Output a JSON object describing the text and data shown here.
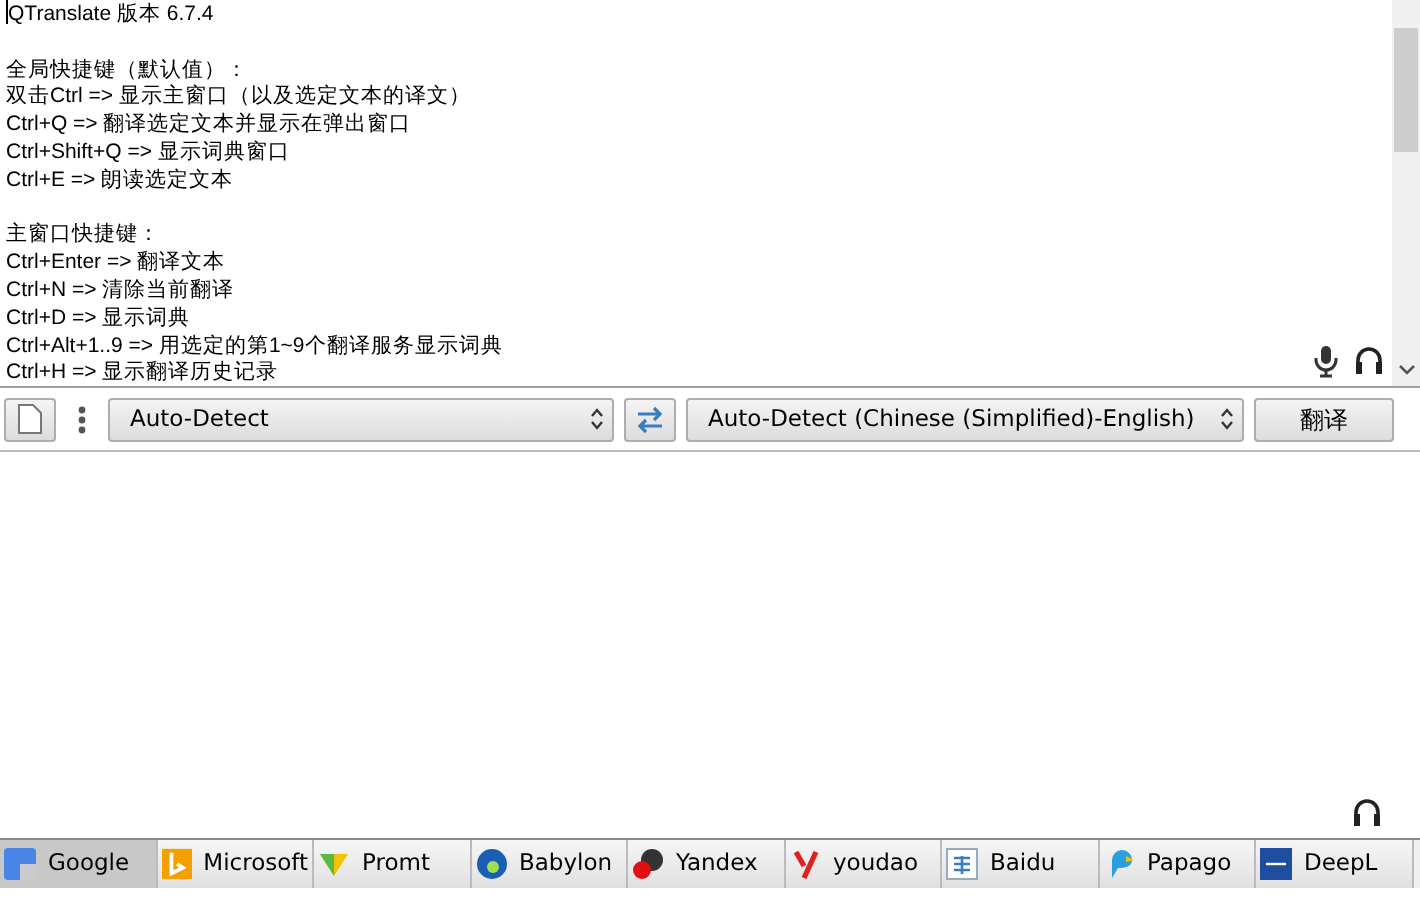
{
  "source_text": {
    "title": "QTranslate 版本 6.7.4",
    "sections": [
      {
        "heading": "全局快捷键（默认值）：",
        "lines": [
          "双击Ctrl => 显示主窗口（以及选定文本的译文）",
          "Ctrl+Q => 翻译选定文本并显示在弹出窗口",
          "Ctrl+Shift+Q => 显示词典窗口",
          "Ctrl+E => 朗读选定文本"
        ]
      },
      {
        "heading": "主窗口快捷键：",
        "lines": [
          "Ctrl+Enter => 翻译文本",
          "Ctrl+N => 清除当前翻译",
          "Ctrl+D => 显示词典",
          "Ctrl+Alt+1..9 => 用选定的第1~9个翻译服务显示词典",
          "Ctrl+H => 显示翻译历史记录"
        ]
      }
    ]
  },
  "toolbar": {
    "source_language": "Auto-Detect",
    "target_language": "Auto-Detect (Chinese (Simplified)-English)",
    "translate_button": "翻译"
  },
  "services": [
    {
      "label": "Google",
      "selected": true
    },
    {
      "label": "Microsoft",
      "selected": false
    },
    {
      "label": "Promt",
      "selected": false
    },
    {
      "label": "Babylon",
      "selected": false
    },
    {
      "label": "Yandex",
      "selected": false
    },
    {
      "label": "youdao",
      "selected": false
    },
    {
      "label": "Baidu",
      "selected": false
    },
    {
      "label": "Papago",
      "selected": false
    },
    {
      "label": "DeepL",
      "selected": false
    }
  ]
}
